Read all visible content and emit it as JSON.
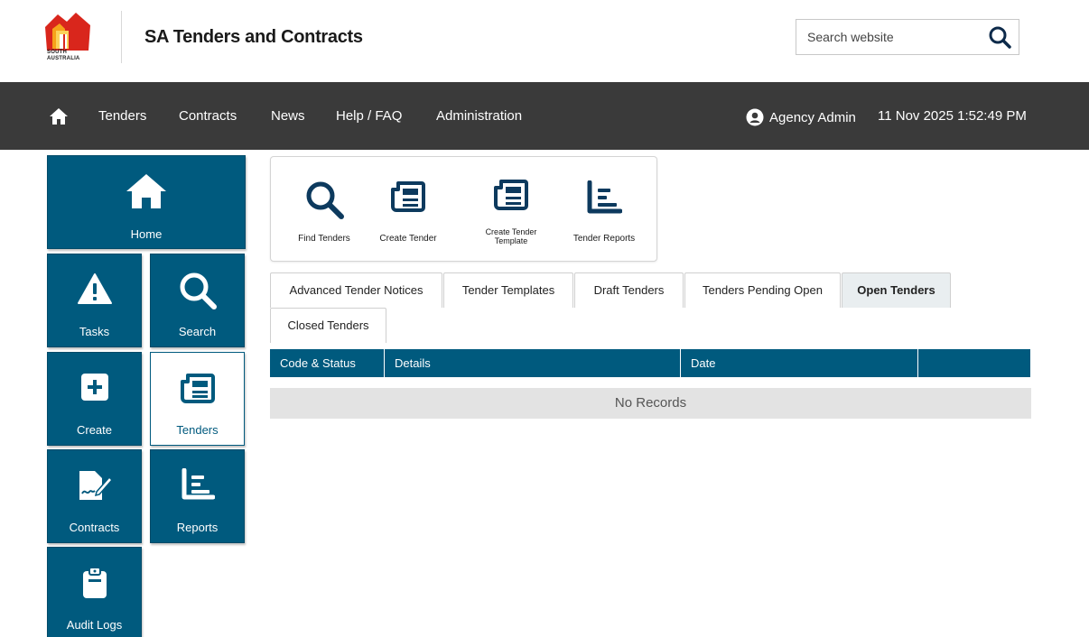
{
  "header": {
    "logo_text": "SOUTH AUSTRALIA",
    "site_title": "SA Tenders and Contracts",
    "search": {
      "placeholder": "Search website",
      "value": ""
    }
  },
  "nav": {
    "items": [
      {
        "label": "Tenders"
      },
      {
        "label": "Contracts"
      },
      {
        "label": "News"
      },
      {
        "label": "Help / FAQ"
      },
      {
        "label": "Administration"
      }
    ],
    "user": "Agency Admin",
    "datetime": "11 Nov 2025 1:52:49 PM"
  },
  "sidebar": {
    "tiles": [
      {
        "label": "Home",
        "icon": "home-icon"
      },
      {
        "label": "Tasks",
        "icon": "warning-icon"
      },
      {
        "label": "Search",
        "icon": "search-icon"
      },
      {
        "label": "Create",
        "icon": "plus-square-icon"
      },
      {
        "label": "Tenders",
        "icon": "newspaper-icon",
        "active": true
      },
      {
        "label": "Contracts",
        "icon": "signature-icon"
      },
      {
        "label": "Reports",
        "icon": "report-icon"
      },
      {
        "label": "Audit Logs",
        "icon": "clipboard-icon"
      }
    ]
  },
  "quick_actions": [
    {
      "label": "Find Tenders",
      "icon": "search-icon"
    },
    {
      "label": "Create Tender",
      "icon": "newspaper-icon"
    },
    {
      "label_line1": "Create Tender",
      "label_line2": "Template",
      "icon": "newspaper-icon"
    },
    {
      "label": "Tender Reports",
      "icon": "report-icon"
    }
  ],
  "tabs": [
    {
      "label": "Advanced Tender Notices"
    },
    {
      "label": "Tender Templates"
    },
    {
      "label": "Draft Tenders"
    },
    {
      "label": "Tenders Pending Open"
    },
    {
      "label": "Open Tenders",
      "active": true
    },
    {
      "label": "Closed Tenders"
    }
  ],
  "table": {
    "columns": [
      "Code & Status",
      "Details",
      "Date",
      ""
    ],
    "empty_message": "No Records"
  },
  "colors": {
    "brand": "#005a7e",
    "navbar": "#3a3a3a",
    "logo_red": "#d9261c"
  }
}
